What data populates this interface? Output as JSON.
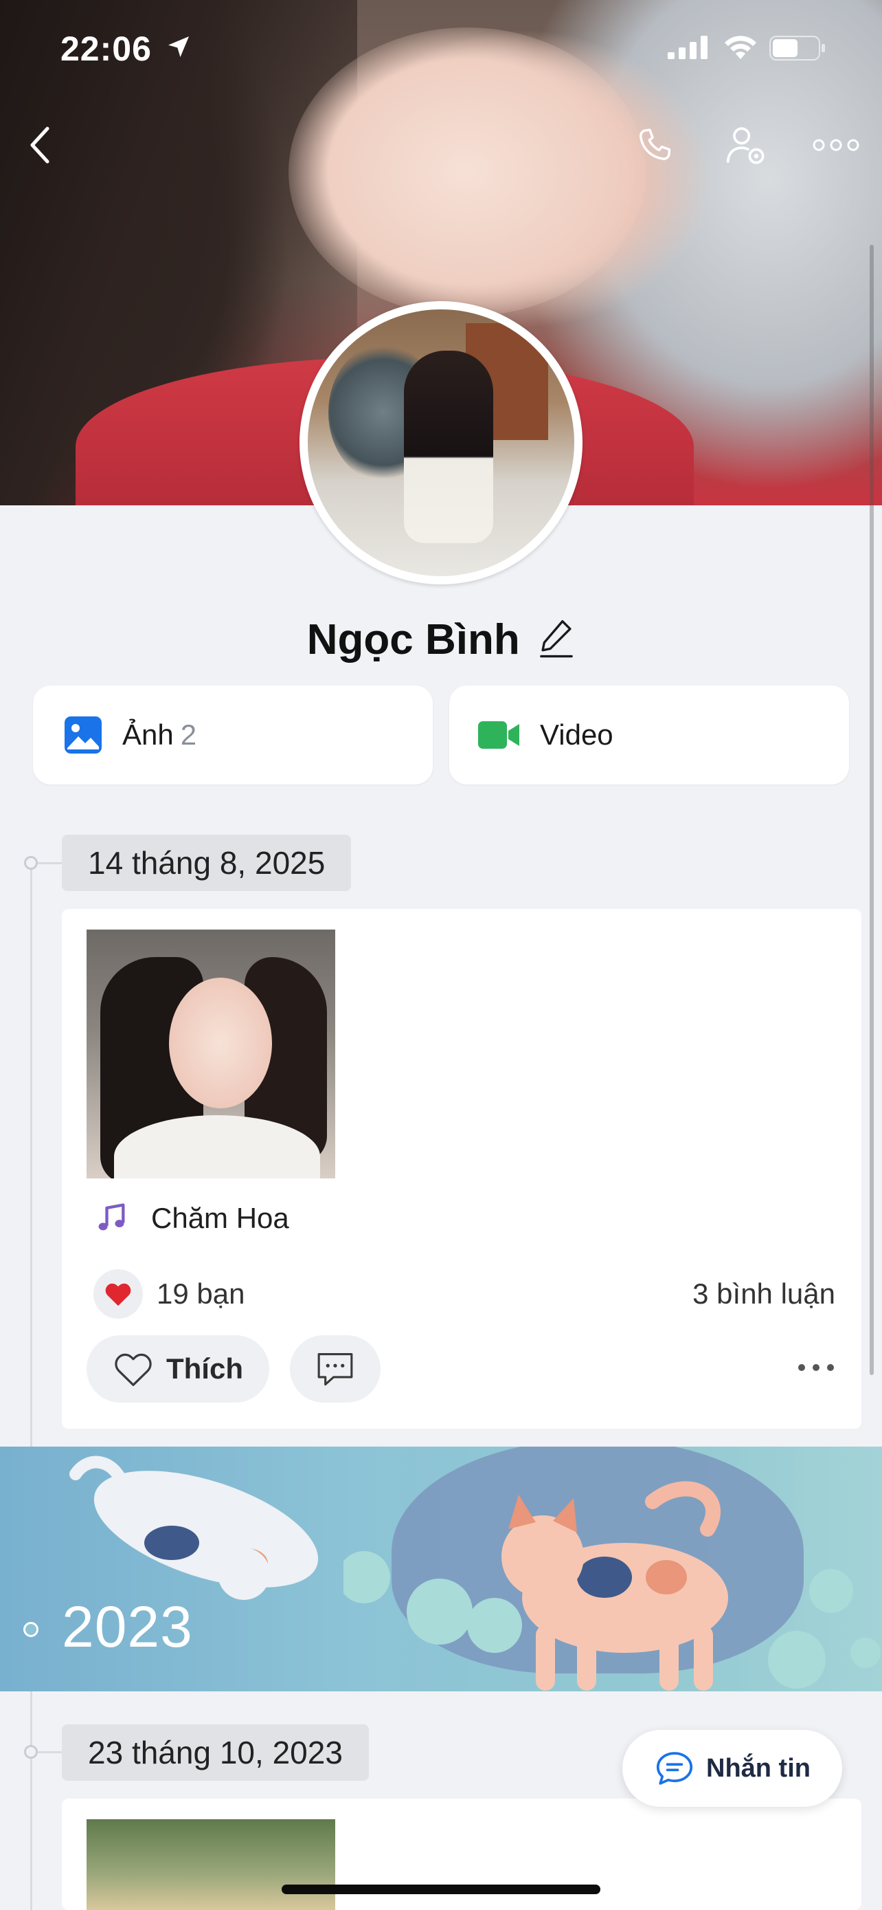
{
  "status_bar": {
    "time": "22:06"
  },
  "profile": {
    "name": "Ngọc Bình"
  },
  "media_tabs": [
    {
      "label": "Ảnh",
      "count": "2"
    },
    {
      "label": "Video"
    }
  ],
  "timeline": [
    {
      "date": "14 tháng 8, 2025",
      "post": {
        "song": "Chăm Hoa",
        "likes": "19 bạn",
        "comments": "3 bình luận",
        "like_label": "Thích"
      }
    },
    {
      "year": "2023"
    },
    {
      "date": "23 tháng 10, 2023"
    }
  ],
  "message_button": {
    "label": "Nhắn tin"
  },
  "colors": {
    "accent_blue": "#1a73e8",
    "video_green": "#2fb35a",
    "music_purple": "#7c5cc4",
    "heart_red": "#e0262e"
  }
}
